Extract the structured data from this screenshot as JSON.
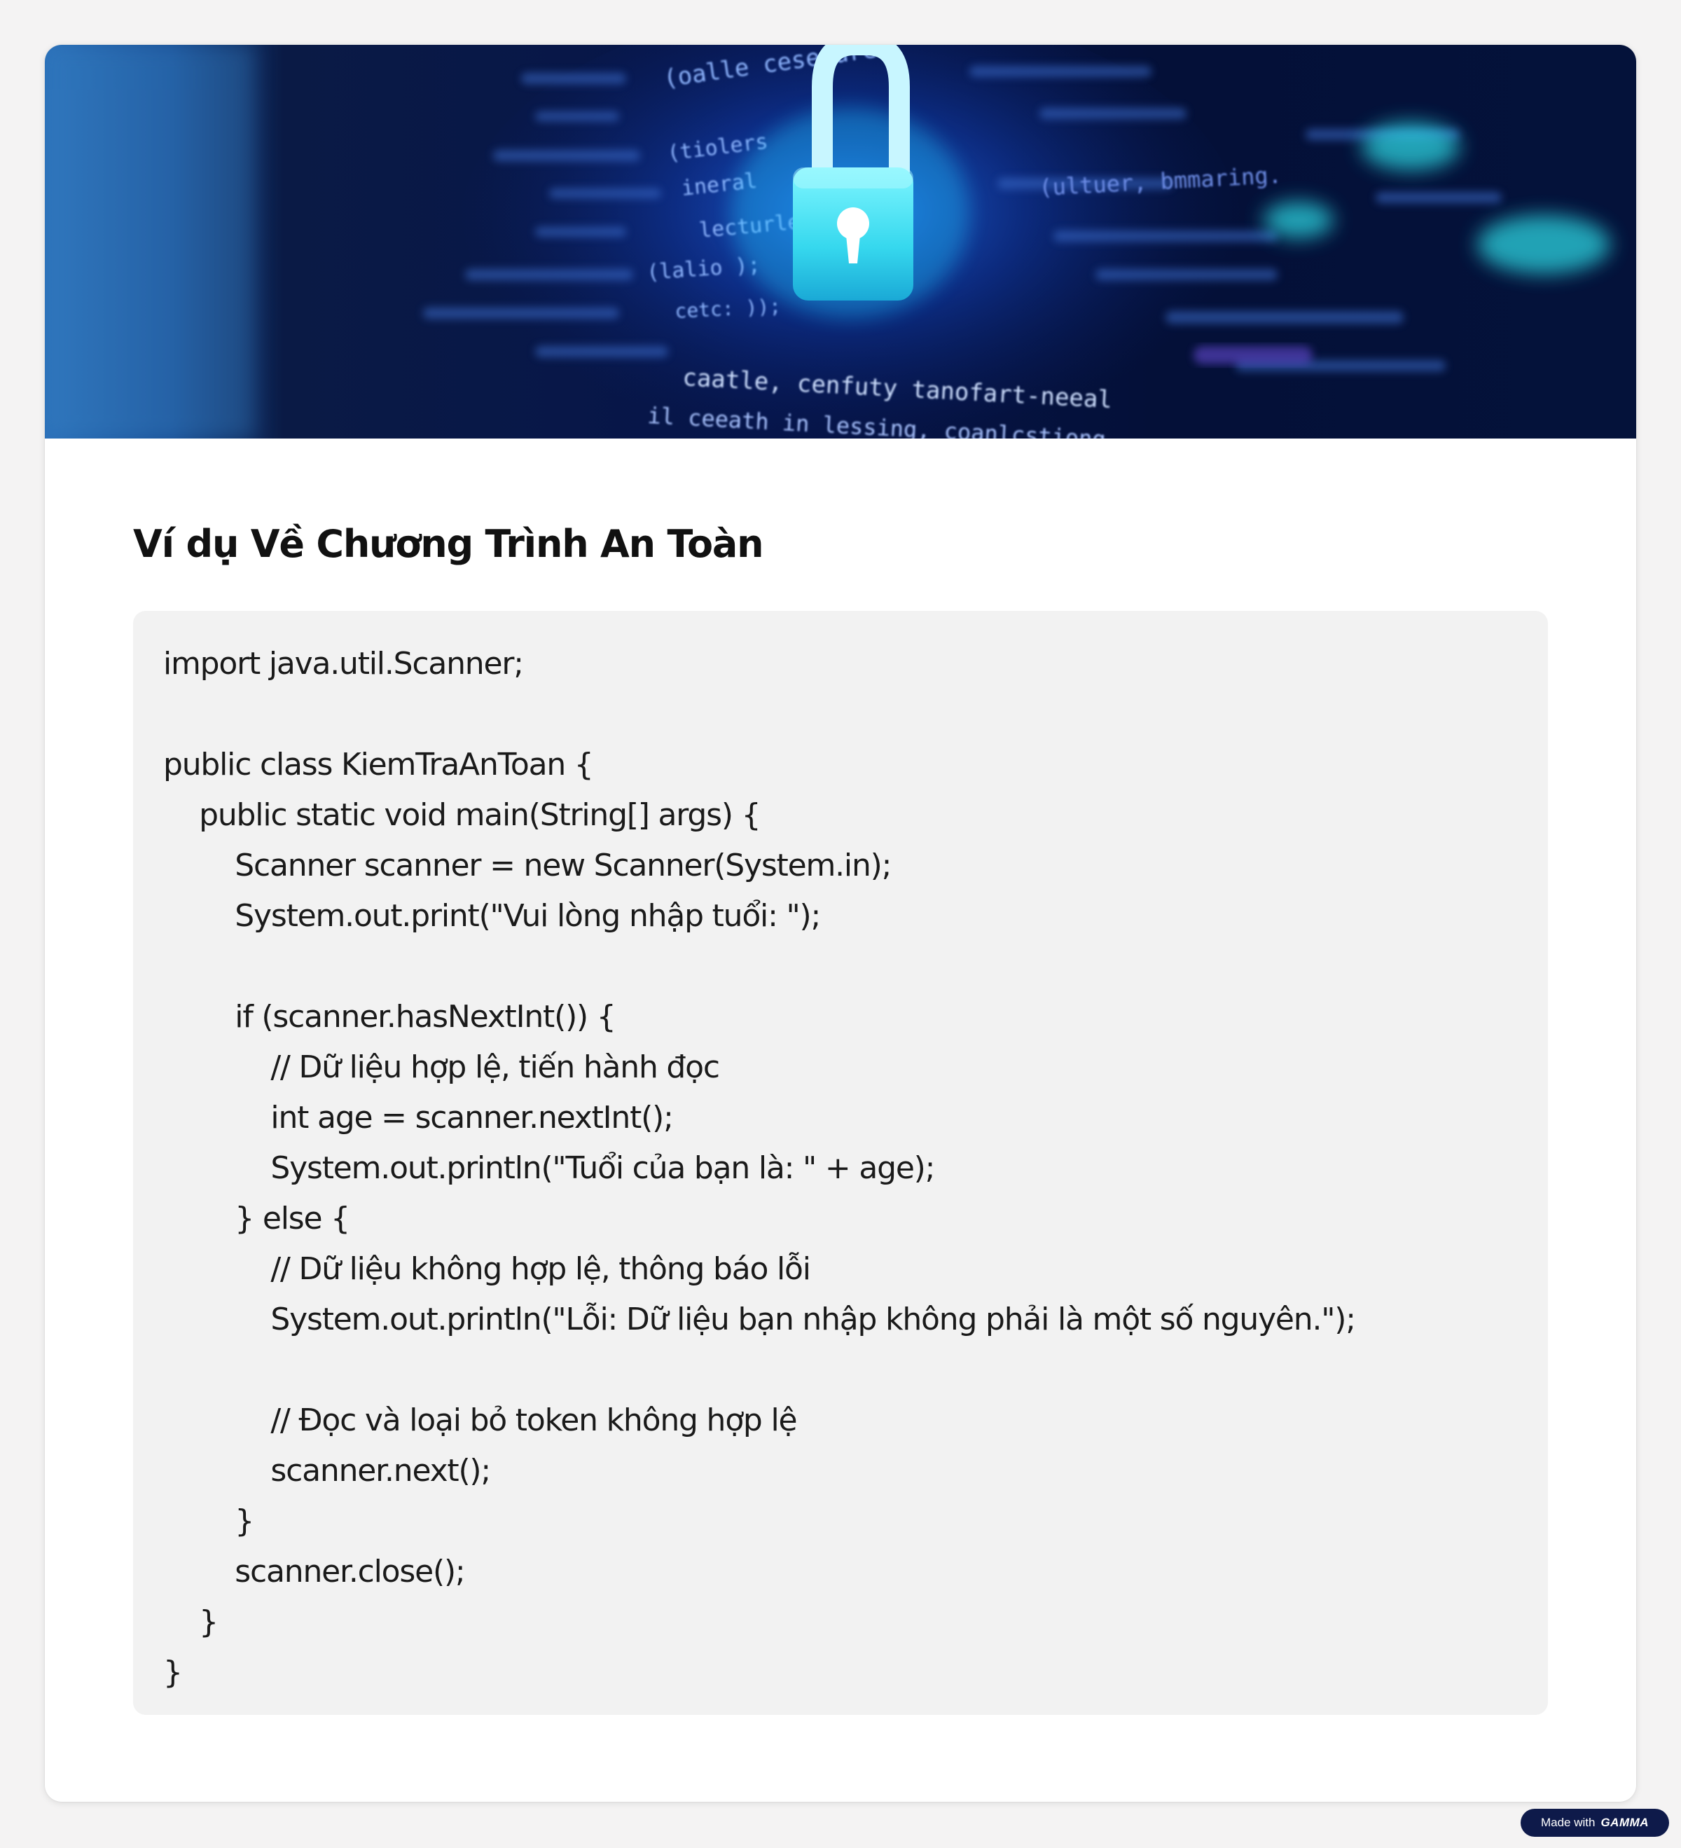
{
  "slide": {
    "title": "Ví dụ Về Chương Trình An Toàn"
  },
  "hero": {
    "icon": "padlock-icon",
    "background_text": [
      "(oalle cesecure",
      "(tiolers",
      "ineral",
      "lecturles",
      "(lalio );",
      "cetc: ));",
      "caatle, cenfuty tanofart-neeal",
      "il ceeath in lessing, coanlcstiong",
      "(ultuer, bmmaring."
    ],
    "colors": {
      "deep": "#02081f",
      "mid": "#0a3fa8",
      "glow": "#39e5f0"
    }
  },
  "code": {
    "language": "java",
    "lines": [
      "import java.util.Scanner;",
      "",
      "public class KiemTraAnToan {",
      "    public static void main(String[] args) {",
      "        Scanner scanner = new Scanner(System.in);",
      "        System.out.print(\"Vui lòng nhập tuổi: \");",
      "",
      "        if (scanner.hasNextInt()) {",
      "            // Dữ liệu hợp lệ, tiến hành đọc",
      "            int age = scanner.nextInt();",
      "            System.out.println(\"Tuổi của bạn là: \" + age);",
      "        } else {",
      "            // Dữ liệu không hợp lệ, thông báo lỗi",
      "            System.out.println(\"Lỗi: Dữ liệu bạn nhập không phải là một số nguyên.\");",
      "",
      "            // Đọc và loại bỏ token không hợp lệ",
      "            scanner.next();",
      "        }",
      "        scanner.close();",
      "    }",
      "}"
    ]
  },
  "badge": {
    "prefix": "Made with",
    "brand": "GAMMA"
  },
  "colors": {
    "page_background": "#f4f3f3",
    "card_background": "#ffffff",
    "code_background": "#f2f2f2",
    "badge_background": "#0e1a4a"
  }
}
